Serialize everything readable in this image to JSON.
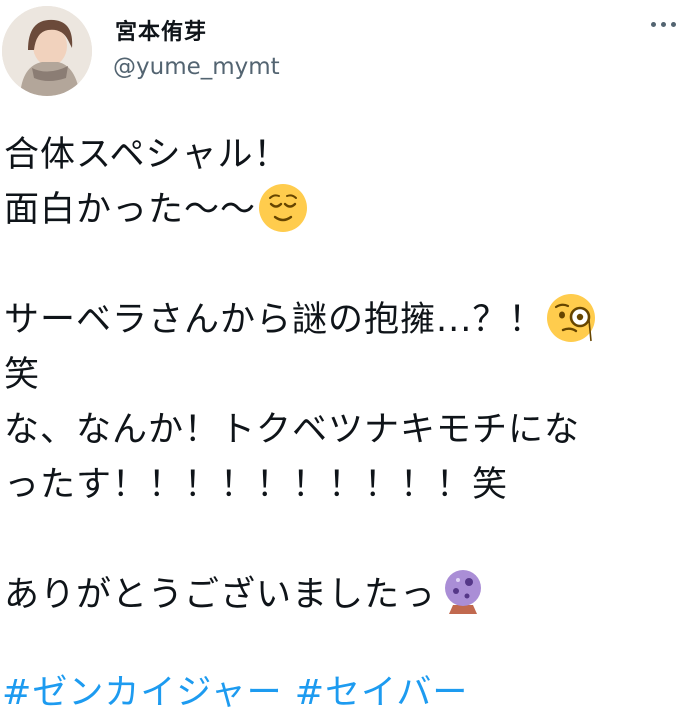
{
  "author": {
    "display_name": "宮本侑芽",
    "username": "@yume_mymt"
  },
  "menu_icon": "more-horizontal-icon",
  "tweet": {
    "lines": [
      "合体スペシャル！",
      "面白かった〜〜",
      "",
      "サーベラさんから謎の抱擁...？！",
      "笑",
      "な、なんか！トクベツナキモチにな",
      "ったす！！！！！！！！！！笑",
      "",
      "ありがとうございましたっ"
    ],
    "emojis": [
      "relieved-face-emoji",
      "face-with-monocle-emoji",
      "crystal-ball-emoji"
    ],
    "hashtags": [
      "#ゼンカイジャー",
      "#セイバー"
    ]
  },
  "colors": {
    "link": "#1d9bf0",
    "secondary_text": "#536471"
  }
}
